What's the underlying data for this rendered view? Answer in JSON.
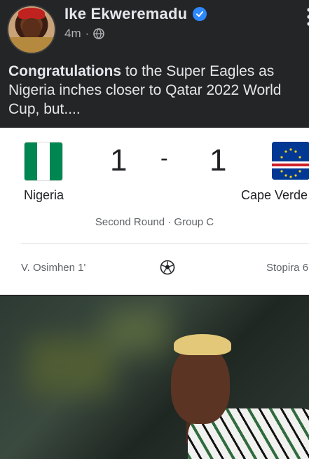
{
  "post": {
    "author": "Ike Ekweremadu",
    "time": "4m",
    "separator": "·",
    "text_bold": "Congratulations",
    "text_line1_rest": " to the Super Eagles as",
    "text_line2": "Nigeria inches closer to Qatar 2022 World",
    "text_line3": "Cup, but...."
  },
  "match": {
    "home_team": "Nigeria",
    "away_team": "Cape Verde",
    "home_score": "1",
    "away_score": "1",
    "dash": "-",
    "round": "Second Round · Group C",
    "home_scorer": "V. Osimhen 1'",
    "away_scorer": "Stopira 6",
    "icons": [
      "nigeria-flag",
      "cape-verde-flag",
      "soccer-ball-icon"
    ]
  },
  "colors": {
    "background": "#242526",
    "verified": "#2d88ff",
    "nigeria_green": "#008751",
    "cape_verde_blue": "#003893",
    "cape_verde_red": "#cf2027"
  }
}
